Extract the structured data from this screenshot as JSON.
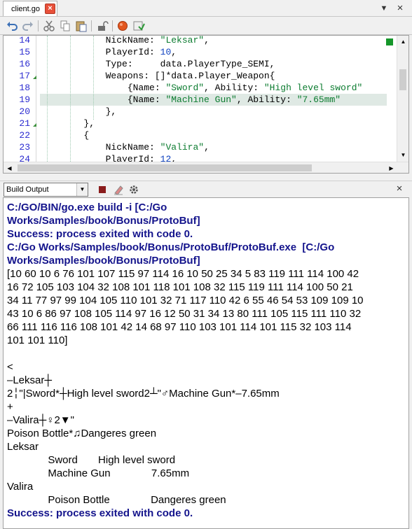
{
  "editor_tab": {
    "filename": "client.go",
    "close_glyph": "×"
  },
  "header_icons": {
    "dropdown": "▼",
    "close": "×"
  },
  "toolbar": {
    "icons": [
      "undo-icon",
      "redo-icon",
      "cut-icon",
      "copy-icon",
      "paste-icon",
      "unlock-icon",
      "breakpoint-icon",
      "save-icon"
    ]
  },
  "code": {
    "lines": [
      {
        "num": "14",
        "indent": "            ",
        "parts": [
          [
            "NickName: ",
            ""
          ],
          [
            "\"Leksar\"",
            "str"
          ],
          [
            ",",
            ""
          ]
        ]
      },
      {
        "num": "15",
        "indent": "            ",
        "parts": [
          [
            "PlayerId: ",
            ""
          ],
          [
            "10",
            "num"
          ],
          [
            ",",
            ""
          ]
        ]
      },
      {
        "num": "16",
        "indent": "            ",
        "parts": [
          [
            "Type:     data.PlayerType_SEMI,",
            ""
          ]
        ]
      },
      {
        "num": "17",
        "indent": "            ",
        "parts": [
          [
            "Weapons: []*data.Player_Weapon{",
            ""
          ]
        ]
      },
      {
        "num": "18",
        "indent": "                ",
        "parts": [
          [
            "{Name: ",
            ""
          ],
          [
            "\"Sword\"",
            "str"
          ],
          [
            ", Ability: ",
            ""
          ],
          [
            "\"High level sword\"",
            "str"
          ]
        ]
      },
      {
        "num": "19",
        "indent": "                ",
        "parts": [
          [
            "{Name: ",
            ""
          ],
          [
            "\"Machine Gun\"",
            "str"
          ],
          [
            ", Ability: ",
            ""
          ],
          [
            "\"7.65mm\"",
            "str"
          ]
        ]
      },
      {
        "num": "20",
        "indent": "            ",
        "parts": [
          [
            "},",
            ""
          ]
        ]
      },
      {
        "num": "21",
        "indent": "        ",
        "parts": [
          [
            "},",
            ""
          ]
        ]
      },
      {
        "num": "22",
        "indent": "        ",
        "parts": [
          [
            "{",
            ""
          ]
        ]
      },
      {
        "num": "23",
        "indent": "            ",
        "parts": [
          [
            "NickName: ",
            ""
          ],
          [
            "\"Valira\"",
            "str"
          ],
          [
            ",",
            ""
          ]
        ]
      },
      {
        "num": "24",
        "indent": "            ",
        "parts": [
          [
            "PlayerId: ",
            ""
          ],
          [
            "12",
            "num"
          ],
          [
            ",",
            ""
          ]
        ]
      }
    ],
    "current_line": "19"
  },
  "output_panel": {
    "selector_value": "Build Output",
    "close_glyph": "×"
  },
  "output": {
    "lines": [
      {
        "text": "C:/GO/BIN/go.exe build -i [C:/Go",
        "style": "cmd"
      },
      {
        "text": "Works/Samples/book/Bonus/ProtoBuf]",
        "style": "cmd"
      },
      {
        "text": "Success: process exited with code 0.",
        "style": "ok"
      },
      {
        "text": "C:/Go Works/Samples/book/Bonus/ProtoBuf/ProtoBuf.exe  [C:/Go",
        "style": "cmd"
      },
      {
        "text": "Works/Samples/book/Bonus/ProtoBuf]",
        "style": "cmd"
      },
      {
        "text": "[10 60 10 6 76 101 107 115 97 114 16 10 50 25 34 5 83 119 111 114 100 42",
        "style": ""
      },
      {
        "text": "16 72 105 103 104 32 108 101 118 101 108 32 115 119 111 114 100 50 21",
        "style": ""
      },
      {
        "text": "34 11 77 97 99 104 105 110 101 32 71 117 110 42 6 55 46 54 53 109 109 10",
        "style": ""
      },
      {
        "text": "43 10 6 86 97 108 105 114 97 16 12 50 31 34 13 80 111 105 115 111 110 32",
        "style": ""
      },
      {
        "text": "66 111 116 116 108 101 42 14 68 97 110 103 101 114 101 115 32 103 114",
        "style": ""
      },
      {
        "text": "101 101 110]",
        "style": ""
      },
      {
        "text": "",
        "style": ""
      },
      {
        "text": "<",
        "style": ""
      },
      {
        "text": "–Leksar┼",
        "style": ""
      },
      {
        "text": "2╎\"|Sword*┼High level sword2┴\"♂Machine Gun*–7.65mm",
        "style": ""
      },
      {
        "text": "+",
        "style": ""
      },
      {
        "text": "–Valira┼♀2▼\"",
        "style": ""
      },
      {
        "text": "Poison Bottle*♫Dangeres green",
        "style": ""
      },
      {
        "text": "Leksar",
        "style": ""
      },
      {
        "text": "              Sword       High level sword",
        "style": ""
      },
      {
        "text": "              Machine Gun              7.65mm",
        "style": ""
      },
      {
        "text": "Valira",
        "style": ""
      },
      {
        "text": "              Poison Bottle              Dangeres green",
        "style": ""
      },
      {
        "text": "Success: process exited with code 0.",
        "style": "ok"
      }
    ]
  },
  "colors": {
    "line_number": "#2b2bd0",
    "string": "#0b7b2f",
    "number": "#0b3fbf",
    "output_command": "#14148c",
    "current_line_bg": "#dfe9e4",
    "tab_close": "#e8503a"
  }
}
